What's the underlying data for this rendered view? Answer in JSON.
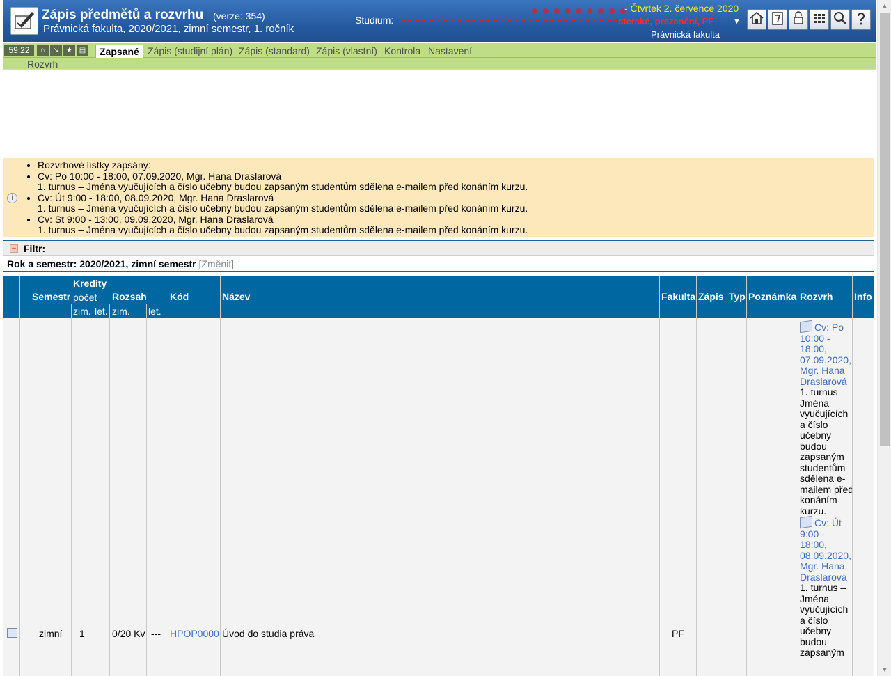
{
  "header": {
    "title": "Zápis předmětů a rozvrhu",
    "version": "(verze: 354)",
    "subtitle": "Právnická fakulta, 2020/2021, zimní semestr, 1. ročník",
    "studium_label": "Studium:",
    "studium_value": "sterské, prezenční, PF",
    "date": "- Čtvrtek 2. července 2020",
    "faculty": "Právnická fakulta",
    "icons": [
      "home-icon",
      "notepad-icon",
      "lock-icon",
      "grid-icon",
      "search-icon",
      "help-icon"
    ]
  },
  "nav": {
    "timer": "59:22",
    "tabs": [
      "Zapsané",
      "Zápis (studijní plán)",
      "Zápis (standard)",
      "Zápis (vlastní)",
      "Kontrola",
      "Nastavení"
    ],
    "active_tab": "Zapsané",
    "sub": "Rozvrh"
  },
  "info": {
    "items": [
      {
        "text": "Rozvrhové lístky zapsány:",
        "note": ""
      },
      {
        "text": "Cv: Po 10:00 - 18:00, 07.09.2020, Mgr. Hana Draslarová",
        "note": "1. turnus – Jména vyučujících a číslo učebny budou zapsaným studentům sdělena e-mailem před konáním kurzu."
      },
      {
        "text": "Cv: Út 9:00 - 18:00, 08.09.2020, Mgr. Hana Draslarová",
        "note": "1. turnus – Jména vyučujících a číslo učebny budou zapsaným studentům sdělena e-mailem před konáním kurzu."
      },
      {
        "text": "Cv: St 9:00 - 13:00, 09.09.2020, Mgr. Hana Draslarová",
        "note": "1. turnus – Jména vyučujících a číslo učebny budou zapsaným studentům sdělena e-mailem před konáním kurzu."
      }
    ]
  },
  "filter": {
    "title": "Filtr:",
    "label": "Rok a semestr: 2020/2021, zimní semestr",
    "change": "[Změnit]"
  },
  "table": {
    "headers": {
      "semestr": "Semestr",
      "kredity": "Kredity",
      "pocet": "počet",
      "zim": "zim.",
      "let": "let.",
      "rozsah": "Rozsah",
      "rozsah_zim": "zim.",
      "rozsah_let": "let.",
      "kod": "Kód",
      "nazev": "Název",
      "fakulta": "Fakulta",
      "zapis": "Zápis",
      "typ": "Typ",
      "poznamka": "Poznámka",
      "rozvrh": "Rozvrh",
      "info": "Info"
    },
    "row": {
      "semestr": "zimní",
      "kredity": "1",
      "rozsah_zim": "0/20 Kv",
      "rozsah_let": "---",
      "kod": "HPOP0000",
      "nazev": "Úvod do studia práva",
      "fakulta": "PF",
      "rozvrh": [
        {
          "link": "Cv: Po 10:00 - 18:00, 07.09.2020, Mgr. Hana Draslarová",
          "note": "1. turnus – Jména vyučujících a číslo učebny budou zapsaným studentům sdělena e-mailem před konáním kurzu."
        },
        {
          "link": "Cv: Út 9:00 - 18:00, 08.09.2020, Mgr. Hana Draslarová",
          "note": "1. turnus – Jména vyučujících a číslo učebny budou zapsaným"
        }
      ]
    }
  }
}
